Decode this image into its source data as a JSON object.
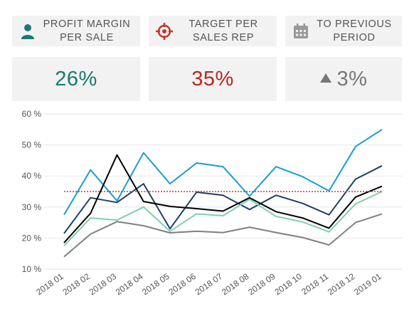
{
  "kpis": [
    {
      "label_line1": "PROFIT MARGIN",
      "label_line2": "PER SALE",
      "value": "26%",
      "icon": "person-icon",
      "icon_color": "#1a7a6d",
      "value_color": "#1a7a6d"
    },
    {
      "label_line1": "TARGET PER",
      "label_line2": "SALES REP",
      "value": "35%",
      "icon": "target-icon",
      "icon_color": "#c0392b",
      "value_color": "#b5281e"
    },
    {
      "label_line1": "TO PREVIOUS",
      "label_line2": "PERIOD",
      "value": "3%",
      "icon": "calendar-icon",
      "icon_color": "#888888",
      "value_color": "#777777",
      "value_prefix_icon": "triangle-up-icon"
    }
  ],
  "chart_data": {
    "type": "line",
    "categories": [
      "2018 01",
      "2018 02",
      "2018 03",
      "2018 04",
      "2018 05",
      "2018 06",
      "2018 07",
      "2018 08",
      "2018 09",
      "2018 10",
      "2018 11",
      "2018 12",
      "2019 01"
    ],
    "y_ticks": [
      "60 %",
      "50 %",
      "40 %",
      "30 %",
      "20 %",
      "10 %"
    ],
    "ylim": [
      10,
      60
    ],
    "target": {
      "value": 35,
      "color": "#c0392b"
    },
    "series": [
      {
        "color": "#1a9cd8",
        "values": [
          27.5,
          42,
          32,
          47.5,
          37.5,
          44.2,
          43,
          33.5,
          43,
          39.8,
          35.2,
          49.5,
          55
        ]
      },
      {
        "color": "#1f3f66",
        "values": [
          21.5,
          33,
          31.5,
          37.5,
          23,
          34.8,
          33.8,
          29.2,
          33.8,
          31.2,
          27.5,
          39,
          43.3
        ]
      },
      {
        "color": "#000000",
        "values": [
          18.5,
          28,
          46.8,
          31.8,
          30.2,
          29.5,
          28.7,
          33,
          28.5,
          26.5,
          23.2,
          33.2,
          36.7
        ]
      },
      {
        "color": "#7fcfb0",
        "values": [
          17.5,
          26.5,
          25.8,
          30,
          22.2,
          27.8,
          27.2,
          32.5,
          27,
          25.2,
          22,
          31,
          35
        ]
      },
      {
        "color": "#808080",
        "values": [
          14,
          21.3,
          25.3,
          24,
          21.7,
          22.2,
          21.8,
          23.5,
          21.8,
          20.2,
          17.8,
          25,
          27.8
        ]
      }
    ]
  }
}
